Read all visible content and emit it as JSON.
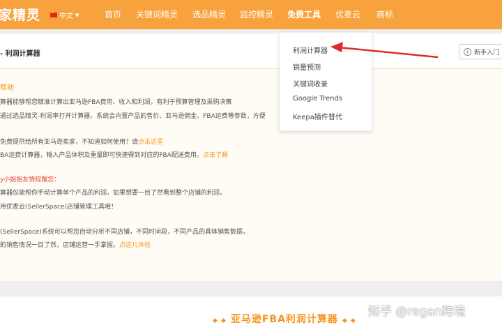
{
  "header": {
    "logo": "家精灵",
    "language": "中文",
    "nav": [
      "首页",
      "关键词精灵",
      "选品精灵",
      "监控精灵",
      "免费工具",
      "优麦云",
      "商标"
    ]
  },
  "dropdown": {
    "items": [
      "利润计算器",
      "销量预测",
      "关键词收录",
      "Google Trends",
      "Keepa插件替代"
    ]
  },
  "page": {
    "breadcrumb": "- 利润计算器",
    "newbie_button": "新手入门"
  },
  "info": {
    "heading": "帮助",
    "line1": "算器能够帮您精准计算出亚马逊FBA费用、收入和利润，有利于预算管理及采购决策",
    "line2": "通过选品精灵-利润率打开计算器，系统会内置产品的售价、亚马逊佣金、FBA运费等参数，方便",
    "line3_pre": "免费提供给所有亚马逊卖家，不知道如何使用？请",
    "line3_link": "点击这里",
    "line4_pre": "BA运费计算器，输入产品体积及重量即可快速得到对应的FBA配送费用。",
    "line4_link": "点击了解",
    "reminder": "y小姐姐友情提醒您：",
    "line5": "算器仅能帮你手动计算单个产品的利润，如果想要一目了然看到整个店铺的利润，",
    "line6": "用优麦云(SellerSpace)店铺管理工具哦！",
    "line7": "(SellerSpace)系统可以帮您自动分析不同店铺，不同时间段，不同产品的具体销售数据，",
    "line8_pre": "的销售情况一目了然，店铺运营一手掌握。",
    "line8_link": "点这儿体验"
  },
  "bottom": {
    "title": "亚马逊FBA利润计算器"
  },
  "watermark": "知乎 @regan跨境",
  "colors": {
    "nav_bg": "#f7a23c",
    "accent": "#f7931e",
    "arrow": "#e02a2a"
  }
}
